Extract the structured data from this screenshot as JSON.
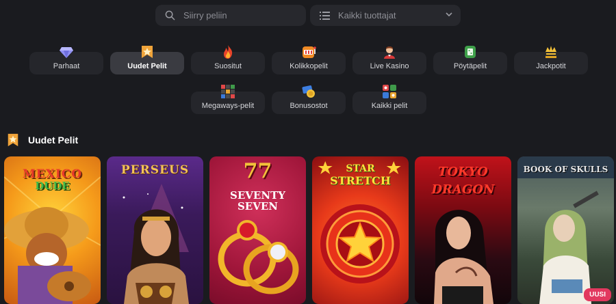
{
  "search": {
    "placeholder": "Siirry peliin"
  },
  "provider": {
    "label": "Kaikki tuottajat"
  },
  "categories": [
    {
      "label": "Parhaat",
      "icon": "diamond-icon"
    },
    {
      "label": "Uudet Pelit",
      "icon": "ribbon-star-icon"
    },
    {
      "label": "Suositut",
      "icon": "fire-icon"
    },
    {
      "label": "Kolikkopelit",
      "icon": "slot-machine-icon"
    },
    {
      "label": "Live Kasino",
      "icon": "dealer-icon"
    },
    {
      "label": "Pöytäpelit",
      "icon": "table-icon"
    },
    {
      "label": "Jackpotit",
      "icon": "jackpot-crown-icon"
    },
    {
      "label": "Megaways-pelit",
      "icon": "megaways-grid-icon"
    },
    {
      "label": "Bonusostot",
      "icon": "bonus-buy-icon"
    },
    {
      "label": "Kaikki pelit",
      "icon": "all-games-icon"
    }
  ],
  "section": {
    "title": "Uudet Pelit"
  },
  "games": [
    {
      "title_line1": "MEXICO",
      "title_line2": "DUDE"
    },
    {
      "title_line1": "PERSEUS"
    },
    {
      "title_line1": "77",
      "title_line2": "SEVENTY",
      "title_line3": "SEVEN"
    },
    {
      "title_line1": "STAR",
      "title_line2": "STRETCH"
    },
    {
      "title_line1": "TOKYO",
      "title_line2": "DRAGON"
    },
    {
      "title_line1": "BOOK OF SKULLS",
      "badge": "UUSI"
    }
  ],
  "colors": {
    "background": "#1a1b1f",
    "tile": "#25262b",
    "active_tile": "#3a3b41",
    "badge": "#e2385f"
  }
}
